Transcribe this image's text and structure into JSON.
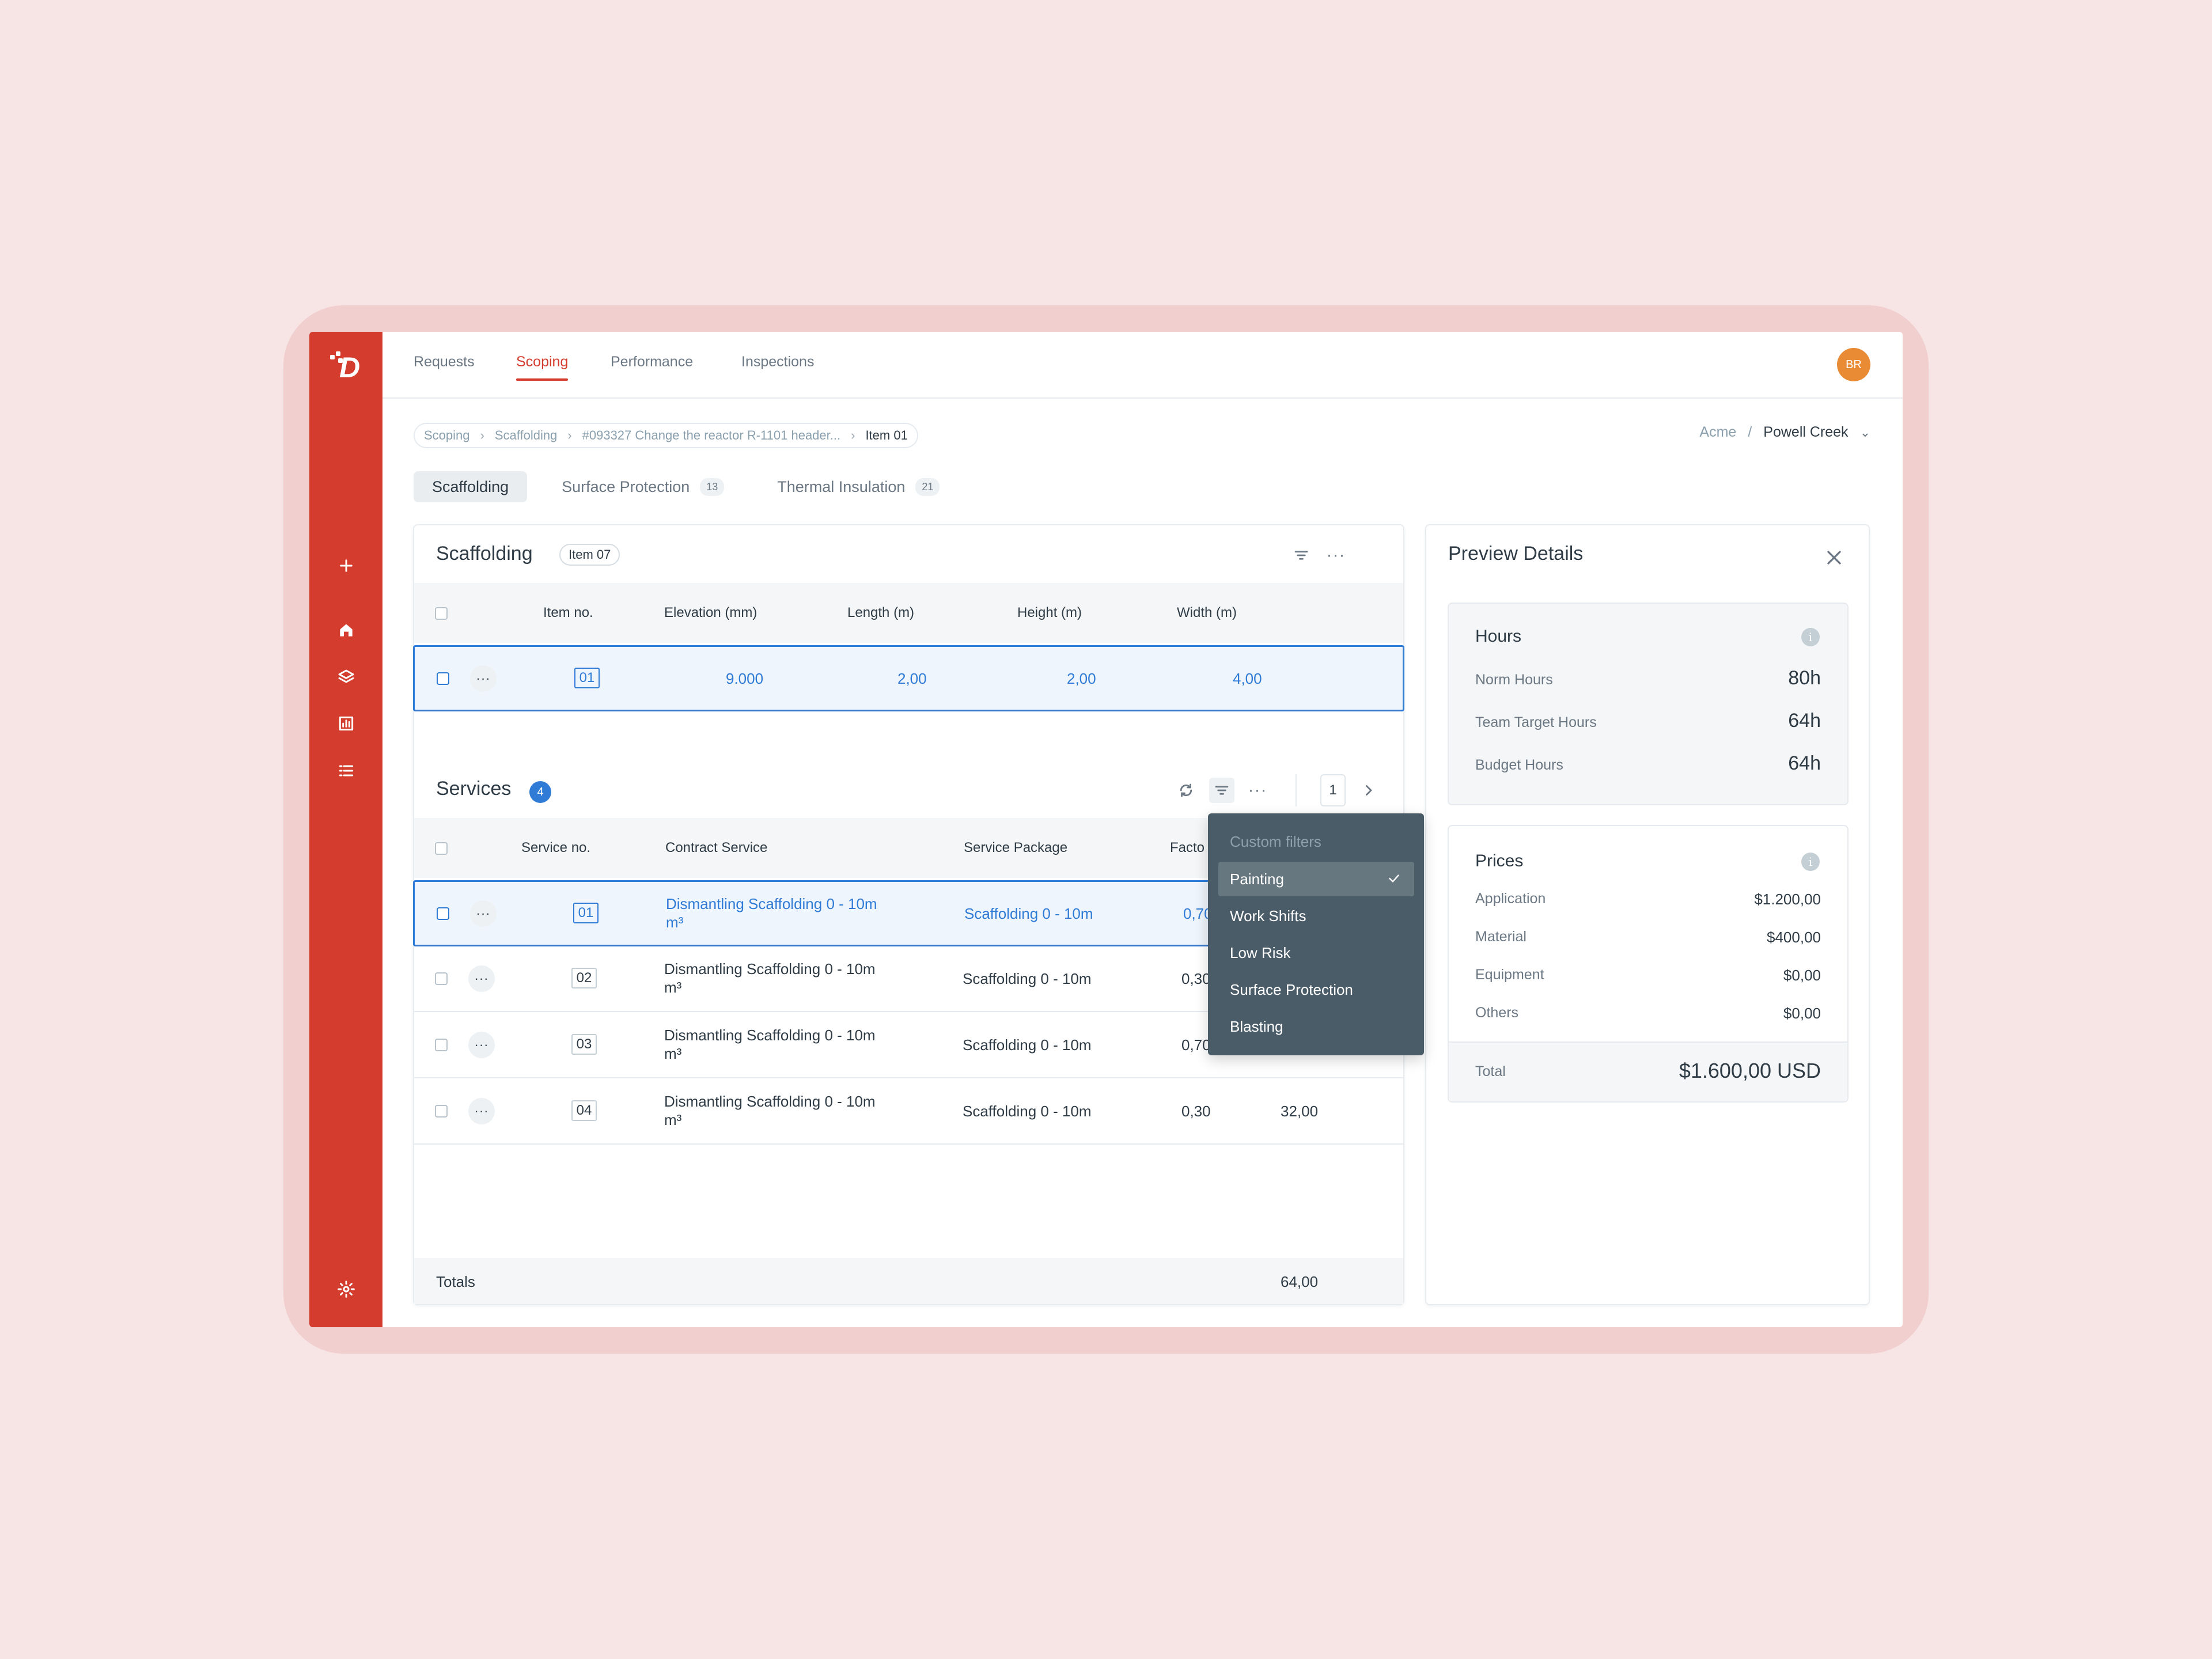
{
  "nav": {
    "items": [
      "Requests",
      "Scoping",
      "Performance",
      "Inspections"
    ],
    "active": "Scoping",
    "avatar_initials": "BR"
  },
  "breadcrumb": {
    "items": [
      "Scoping",
      "Scaffolding",
      "#093327 Change the reactor R-1101 header...",
      "Item 01"
    ]
  },
  "org": {
    "company": "Acme",
    "separator": "/",
    "site": "Powell Creek"
  },
  "tabs": [
    {
      "label": "Scaffolding",
      "count": ""
    },
    {
      "label": "Surface Protection",
      "count": "13"
    },
    {
      "label": "Thermal Insulation",
      "count": "21"
    }
  ],
  "scaffolding": {
    "title": "Scaffolding",
    "tag": "Item 07",
    "columns": [
      "Item no.",
      "Elevation (mm)",
      "Length (m)",
      "Height (m)",
      "Width (m)"
    ],
    "rows": [
      {
        "item_no": "01",
        "elevation": "9.000",
        "length": "2,00",
        "height": "2,00",
        "width": "4,00"
      }
    ]
  },
  "services": {
    "title": "Services",
    "count": "4",
    "page": "1",
    "columns": [
      "Service no.",
      "Contract Service",
      "Service Package",
      "Facto"
    ],
    "rows": [
      {
        "no": "01",
        "contract": "Dismantling Scaffolding 0 - 10m",
        "unit": "m³",
        "package": "Scaffolding 0 - 10m",
        "factor": "0,70",
        "value": ""
      },
      {
        "no": "02",
        "contract": "Dismantling Scaffolding 0 - 10m",
        "unit": "m³",
        "package": "Scaffolding 0 - 10m",
        "factor": "0,30",
        "value": ""
      },
      {
        "no": "03",
        "contract": "Dismantling Scaffolding 0 - 10m",
        "unit": "m³",
        "package": "Scaffolding 0 - 10m",
        "factor": "0,70",
        "value": ""
      },
      {
        "no": "04",
        "contract": "Dismantling Scaffolding 0 - 10m",
        "unit": "m³",
        "package": "Scaffolding 0 - 10m",
        "factor": "0,30",
        "value": "32,00"
      }
    ],
    "totals_label": "Totals",
    "totals_value": "64,00"
  },
  "filter_dropdown": {
    "header": "Custom filters",
    "items": [
      "Painting",
      "Work Shifts",
      "Low Risk",
      "Surface Protection",
      "Blasting"
    ],
    "selected": "Painting"
  },
  "preview": {
    "title": "Preview Details",
    "hours": {
      "title": "Hours",
      "rows": [
        {
          "label": "Norm Hours",
          "value": "80h"
        },
        {
          "label": "Team Target Hours",
          "value": "64h"
        },
        {
          "label": "Budget Hours",
          "value": "64h"
        }
      ]
    },
    "prices": {
      "title": "Prices",
      "rows": [
        {
          "label": "Application",
          "value": "$1.200,00"
        },
        {
          "label": "Material",
          "value": "$400,00"
        },
        {
          "label": "Equipment",
          "value": "$0,00"
        },
        {
          "label": "Others",
          "value": "$0,00"
        }
      ],
      "total_label": "Total",
      "total_value": "$1.600,00 USD"
    }
  },
  "colors": {
    "brand": "#d43c2e",
    "accent": "#2f7bd6",
    "avatar": "#e98a35",
    "dropdown": "#4a5c68"
  }
}
